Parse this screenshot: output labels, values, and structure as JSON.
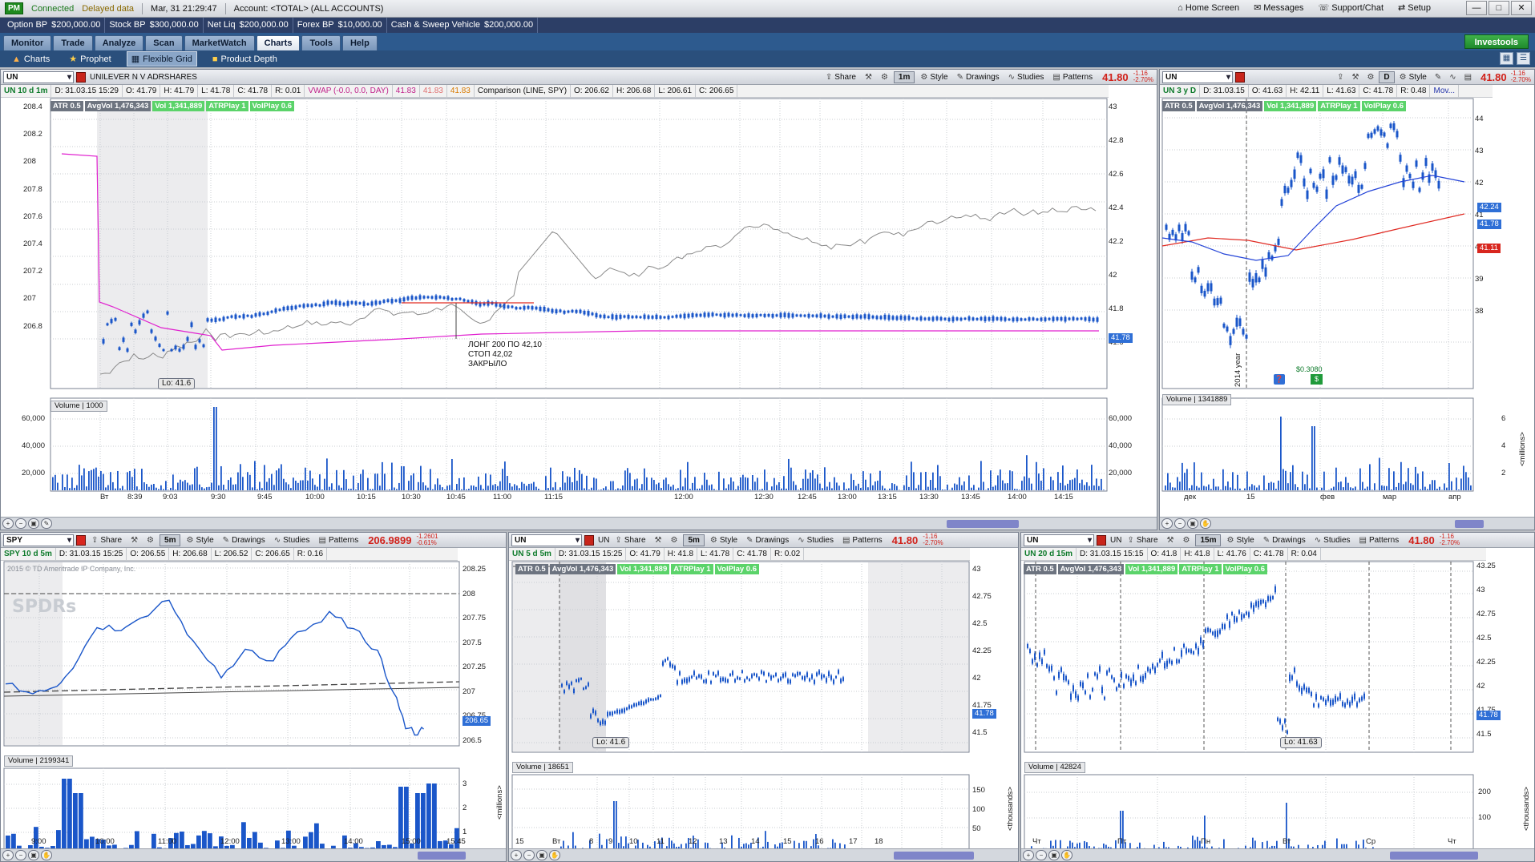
{
  "top": {
    "pm": "PM",
    "connected": "Connected",
    "delayed": "Delayed data",
    "datetime": "Mar, 31  21:29:47",
    "account": "Account: <TOTAL> (ALL ACCOUNTS)",
    "home": "Home Screen",
    "messages": "Messages",
    "support": "Support/Chat",
    "setup": "Setup"
  },
  "bp": [
    {
      "label": "Option BP",
      "value": "$200,000.00"
    },
    {
      "label": "Stock BP",
      "value": "$300,000.00"
    },
    {
      "label": "Net Liq",
      "value": "$200,000.00"
    },
    {
      "label": "Forex BP",
      "value": "$10,000.00"
    },
    {
      "label": "Cash & Sweep Vehicle",
      "value": "$200,000.00"
    }
  ],
  "tabs": [
    "Monitor",
    "Trade",
    "Analyze",
    "Scan",
    "MarketWatch",
    "Charts",
    "Tools",
    "Help"
  ],
  "investools": "Investools",
  "subtabs": [
    "Charts",
    "Prophet",
    "Flexible Grid",
    "Product Depth"
  ],
  "toolbar": {
    "share": "Share",
    "style": "Style",
    "drawings": "Drawings",
    "studies": "Studies",
    "patterns": "Patterns"
  },
  "studies": {
    "atr": "ATR 0.5",
    "avgvol": "AvgVol 1,476,343",
    "vol": "Vol 1,341,889",
    "atrplay": "ATRPlay 1",
    "volplay": "VolPlay 0.6",
    "copy": "2015 © TD Ameritrade IP Company, Inc.",
    "copyshort": "2015 © TDA"
  },
  "main": {
    "symbol": "UN",
    "desc": "UNILEVER N V ADRSHARES",
    "tf": "1m",
    "price": "41.80",
    "chg1": "-1.16",
    "chg2": "-2.70%",
    "ohlc": {
      "name": "UN 10 d 1m",
      "d": "D: 31.03.15 15:29",
      "o": "O: 41.79",
      "h": "H: 41.79",
      "l": "L: 41.78",
      "c": "C: 41.78",
      "r": "R: 0.01"
    },
    "vwap": "VWAP (-0.0, 0.0, DAY)",
    "vw1": "41.83",
    "vw2": "41.83",
    "vw3": "41.83",
    "comp": "Comparison (LINE, SPY)",
    "co": "O: 206.62",
    "ch": "H: 206.68",
    "cl": "L: 206.61",
    "cc": "C: 206.65",
    "leftaxis": [
      "208.4",
      "208.2",
      "208",
      "207.8",
      "207.6",
      "207.4",
      "207.2",
      "207",
      "206.8"
    ],
    "rightaxis": [
      "43",
      "42.8",
      "42.6",
      "42.4",
      "42.2",
      "42",
      "41.8",
      "41.6"
    ],
    "lastprice": "41.78",
    "lo": "Lo: 41.6",
    "annot": [
      "ЛОНГ 200 ПО 42,10",
      "СТОП 42,02",
      "ЗАКРЫЛО"
    ],
    "vol_label": "Volume",
    "vol_val": "1000",
    "vol_axis": [
      "60,000",
      "40,000",
      "20,000"
    ],
    "xaxis": [
      "Вт",
      "8:39",
      "9:03",
      "9:30",
      "9:45",
      "10:00",
      "10:15",
      "10:30",
      "10:45",
      "11:00",
      "11:15",
      "12:00",
      "12:30",
      "12:45",
      "13:00",
      "13:15",
      "13:30",
      "13:45",
      "14:00",
      "14:15"
    ]
  },
  "tr": {
    "symbol": "UN",
    "tf": "D",
    "price": "41.80",
    "chg1": "-1.16",
    "chg2": "-2.70%",
    "ohlc": {
      "name": "UN 3 y D",
      "d": "D: 31.03.15",
      "o": "O: 41.63",
      "h": "H: 42.11",
      "l": "L: 41.63",
      "c": "C: 41.78",
      "r": "R: 0.48",
      "mov": "Mov..."
    },
    "axis": [
      "44",
      "43",
      "42",
      "41",
      "40",
      "39",
      "38"
    ],
    "tag1": "42.24",
    "tag2": "41.78",
    "tag3": "41.11",
    "yearlabel": "2014 year",
    "divlabel": "$0.3080",
    "vol_label": "Volume",
    "vol_val": "1341889",
    "vol_axis": [
      "6",
      "4",
      "2"
    ],
    "vol_unit": "<millions>",
    "xaxis": [
      "дек",
      "15",
      "фев",
      "мар",
      "апр"
    ]
  },
  "bl": {
    "symbol": "SPY",
    "tf": "5m",
    "price": "206.9899",
    "chg1": "-1.2601",
    "chg2": "-0.61%",
    "ohlc": {
      "name": "SPY 10 d 5m",
      "d": "D: 31.03.15 15:25",
      "o": "O: 206.55",
      "h": "H: 206.68",
      "l": "L: 206.52",
      "c": "C: 206.65",
      "r": "R: 0.16"
    },
    "copy": "2015 © TD Ameritrade IP Company, Inc.",
    "logo": "SPDRs",
    "axis": [
      "208.25",
      "208",
      "207.75",
      "207.5",
      "207.25",
      "207",
      "206.75",
      "206.5"
    ],
    "lastprice": "206.65",
    "vol_label": "Volume",
    "vol_val": "2199341",
    "vol_axis": [
      "3",
      "2",
      "1"
    ],
    "vol_unit": "<millions>",
    "xaxis": [
      "9:00",
      "10:00",
      "11:00",
      "12:00",
      "13:00",
      "14:00",
      "15:00",
      "15:45"
    ]
  },
  "bm": {
    "symbol": "UN",
    "sym2": "UN",
    "tf": "5m",
    "price": "41.80",
    "chg1": "-1.16",
    "chg2": "-2.70%",
    "ohlc": {
      "name": "UN 5 d 5m",
      "d": "D: 31.03.15 15:25",
      "o": "O: 41.79",
      "h": "H: 41.8",
      "l": "L: 41.78",
      "c": "C: 41.78",
      "r": "R: 0.02"
    },
    "axis": [
      "43",
      "42.75",
      "42.5",
      "42.25",
      "42",
      "41.75",
      "41.5"
    ],
    "lastprice": "41.78",
    "lo": "Lo: 41.6",
    "vol_label": "Volume",
    "vol_val": "18651",
    "vol_axis": [
      "150",
      "100",
      "50"
    ],
    "vol_unit": "<thousands>",
    "xaxis": [
      "15",
      "Вт",
      "8",
      "9",
      "10",
      "11",
      "12",
      "13",
      "14",
      "15",
      "16",
      "17",
      "18"
    ]
  },
  "br": {
    "symbol": "UN",
    "sym2": "UN",
    "tf": "15m",
    "price": "41.80",
    "chg1": "-1.16",
    "chg2": "-2.70%",
    "ohlc": {
      "name": "UN 20 d 15m",
      "d": "D: 31.03.15 15:15",
      "o": "O: 41.8",
      "h": "H: 41.8",
      "l": "L: 41.76",
      "c": "C: 41.78",
      "r": "R: 0.04"
    },
    "axis": [
      "43.25",
      "43",
      "42.75",
      "42.5",
      "42.25",
      "42",
      "41.75",
      "41.5"
    ],
    "lastprice": "41.78",
    "lo": "Lo: 41.63",
    "vol_label": "Volume",
    "vol_val": "42824",
    "vol_axis": [
      "200",
      "100"
    ],
    "vol_unit": "<thousands>",
    "xaxis": [
      "Чт",
      "Пт",
      "Пн",
      "Вт",
      "Ср",
      "Чт"
    ]
  },
  "colors": {
    "candle": "#1a56c9",
    "vwap": "#e01fcf",
    "comparison": "#8a8a8a",
    "ma_red": "#e02a22",
    "ma_blue": "#2444d8",
    "tag_blue": "#2f6fd6",
    "tag_red": "#d8261e"
  }
}
